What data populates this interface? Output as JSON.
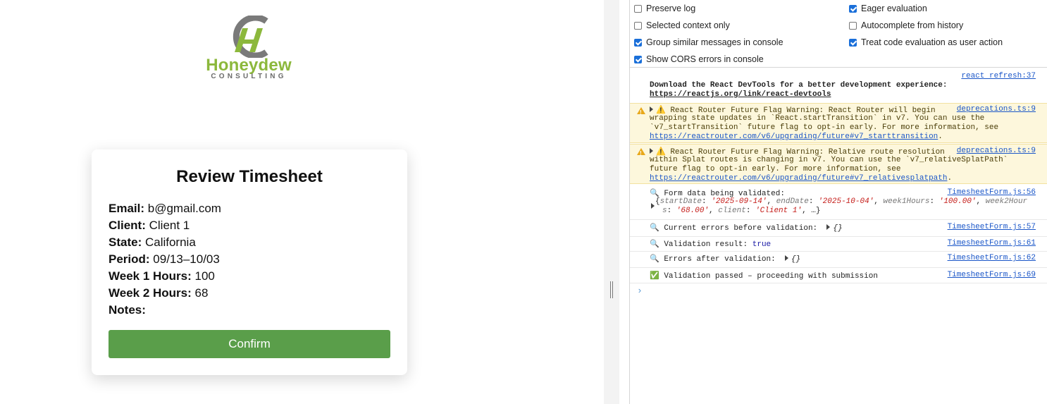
{
  "logo": {
    "word": "Honeydew",
    "sub": "CONSULTING",
    "colors": {
      "green": "#8cb83c",
      "gray": "#6b6b6b"
    }
  },
  "card": {
    "title": "Review Timesheet",
    "fields": [
      {
        "label": "Email:",
        "value": "b@gmail.com"
      },
      {
        "label": "Client:",
        "value": "Client 1"
      },
      {
        "label": "State:",
        "value": "California"
      },
      {
        "label": "Period:",
        "value": "09/13–10/03"
      },
      {
        "label": "Week 1 Hours:",
        "value": "100"
      },
      {
        "label": "Week 2 Hours:",
        "value": "68"
      },
      {
        "label": "Notes:",
        "value": ""
      }
    ],
    "confirm_label": "Confirm",
    "confirm_color": "#5a9e4a"
  },
  "devtools": {
    "settings": [
      {
        "label": "Preserve log",
        "checked": false
      },
      {
        "label": "Eager evaluation",
        "checked": true
      },
      {
        "label": "Selected context only",
        "checked": false
      },
      {
        "label": "Autocomplete from history",
        "checked": false
      },
      {
        "label": "Group similar messages in console",
        "checked": true
      },
      {
        "label": "Treat code evaluation as user action",
        "checked": true
      },
      {
        "label": "Show CORS errors in console",
        "checked": true
      }
    ],
    "messages": {
      "react_devtools": {
        "source": "react refresh:37",
        "text": "Download the React DevTools for a better development experience:",
        "link": "https://reactjs.org/link/react-devtools"
      },
      "warn1": {
        "source": "deprecations.ts:9",
        "line1": "React Router Future Flag Warning: React Router will begin",
        "line2": "wrapping state updates in `React.startTransition` in v7. You can use the",
        "line3": "`v7_startTransition` future flag to opt-in early. For more information, see",
        "link": "https://reactrouter.com/v6/upgrading/future#v7_starttransition",
        "after": "."
      },
      "warn2": {
        "source": "deprecations.ts:9",
        "line1": "React Router Future Flag Warning: Relative route resolution",
        "line2": "within Splat routes is changing in v7. You can use the `v7_relativeSplatPath`",
        "line3": "future flag to opt-in early. For more information, see",
        "link": "https://reactrouter.com/v6/upgrading/future#v7_relativesplatpath",
        "after": "."
      },
      "form_data": {
        "source": "TimesheetForm.js:56",
        "text": "Form data being validated:",
        "k1": "startDate",
        "v1": "'2025-09-14'",
        "k2": "endDate",
        "v2": "'2025-10-04'",
        "k3": "week1Hours",
        "v3": "'100.00'",
        "k4a": "week2Hour",
        "k4b": "s",
        "v4": "'68.00'",
        "k5": "client",
        "v5": "'Client 1'"
      },
      "current_errors": {
        "source": "TimesheetForm.js:57",
        "text": "Current errors before validation:",
        "obj": "{}"
      },
      "validation_result": {
        "source": "TimesheetForm.js:61",
        "text": "Validation result:",
        "value": "true"
      },
      "errors_after": {
        "source": "TimesheetForm.js:62",
        "text": "Errors after validation:",
        "obj": "{}"
      },
      "passed": {
        "source": "TimesheetForm.js:69",
        "text": "Validation passed – proceeding with submission"
      }
    },
    "prompt": "›"
  }
}
